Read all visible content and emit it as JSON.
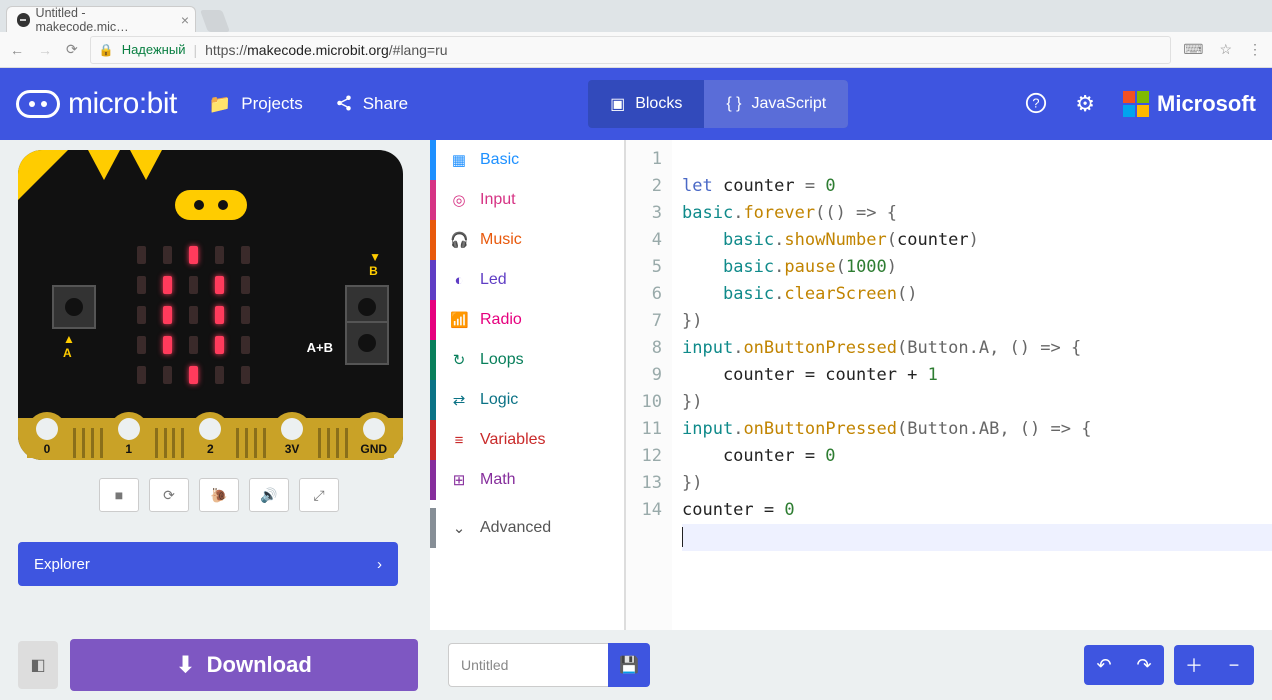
{
  "browser": {
    "tab_title": "Untitled - makecode.mic…",
    "secure_label": "Надежный",
    "url_prefix": "https://",
    "url_host": "makecode.microbit.org",
    "url_path": "/#lang=ru"
  },
  "header": {
    "logo_text": "micro:bit",
    "projects": "Projects",
    "share": "Share",
    "blocks": "Blocks",
    "javascript": "JavaScript",
    "microsoft": "Microsoft"
  },
  "board": {
    "pin0": "0",
    "pin1": "1",
    "pin2": "2",
    "pin3v": "3V",
    "pinGnd": "GND",
    "labelA": "A",
    "labelB": "B",
    "labelAB": "A+B"
  },
  "explorer_label": "Explorer",
  "categories": {
    "basic": "Basic",
    "input": "Input",
    "music": "Music",
    "led": "Led",
    "radio": "Radio",
    "loops": "Loops",
    "logic": "Logic",
    "variables": "Variables",
    "math": "Math",
    "advanced": "Advanced"
  },
  "code": {
    "l1_let": "let",
    "l1_id": "counter",
    "l1_eq": " = ",
    "l1_num": "0",
    "l2_obj": "basic",
    "l2_fn": "forever",
    "l2_tail": "(() => {",
    "l3_obj": "basic",
    "l3_fn": "showNumber",
    "l3_arg": "counter",
    "l3_open": "(",
    "l3_close": ")",
    "l4_obj": "basic",
    "l4_fn": "pause",
    "l4_open": "(",
    "l4_num": "1000",
    "l4_close": ")",
    "l5_obj": "basic",
    "l5_fn": "clearScreen",
    "l5_par": "()",
    "l6": "})",
    "l7_obj": "input",
    "l7_fn": "onButtonPressed",
    "l7_tail": "(Button.A, () => {",
    "l8": "    counter = counter + ",
    "l8_num": "1",
    "l9": "})",
    "l10_obj": "input",
    "l10_fn": "onButtonPressed",
    "l10_tail": "(Button.AB, () => {",
    "l11": "    counter = ",
    "l11_num": "0",
    "l12": "})",
    "l13": "counter = ",
    "l13_num": "0",
    "pad": "    ",
    "dot": "."
  },
  "linenums": [
    "1",
    "2",
    "3",
    "4",
    "5",
    "6",
    "7",
    "8",
    "9",
    "10",
    "11",
    "12",
    "13",
    "14"
  ],
  "bottom": {
    "download": "Download",
    "filename": "Untitled"
  }
}
